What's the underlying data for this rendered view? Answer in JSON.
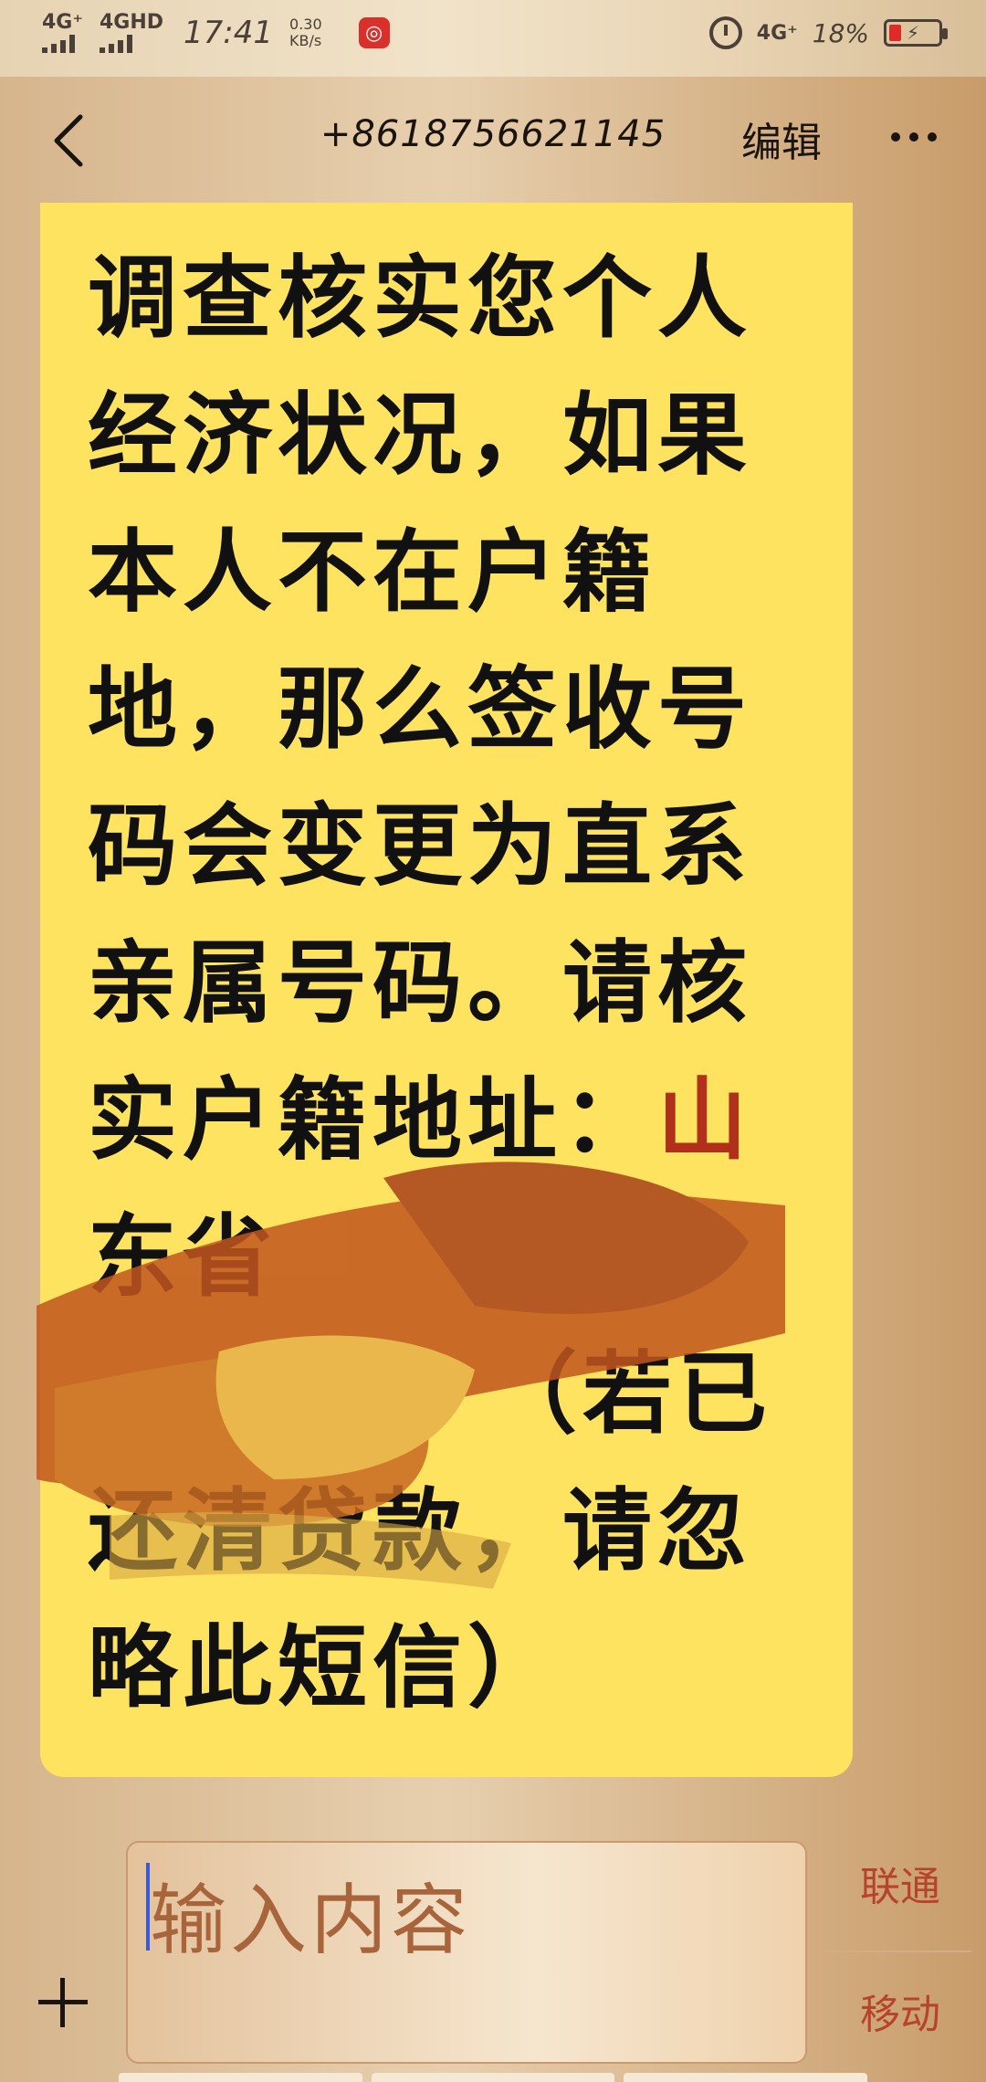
{
  "status_bar": {
    "signal1": "4G⁺",
    "signal2": "4GHD",
    "time": "17:41",
    "speed_value": "0.30",
    "speed_unit": "KB/s",
    "network_right": "4G⁺",
    "battery_pct": "18%",
    "battery_level": 0.18,
    "app_icon": "netease-music-icon"
  },
  "header": {
    "title": "+8618756621145",
    "edit_label": "编辑"
  },
  "message": {
    "lines": [
      "调查核实您个人",
      "经济状况，如果",
      "本人不在户籍",
      "地，那么签收号",
      "码会变更为直系",
      "亲属号码。请核",
      "实户籍地址：",
      "东省",
      "（若已",
      "还清贷款，请忽",
      "略此短信）"
    ],
    "redacted_prefix": "山",
    "colors": {
      "bubble": "#fde35f",
      "redacted": "#b0301c"
    }
  },
  "composer": {
    "placeholder": "输入内容",
    "sim1_label": "联通",
    "sim2_label": "移动"
  }
}
